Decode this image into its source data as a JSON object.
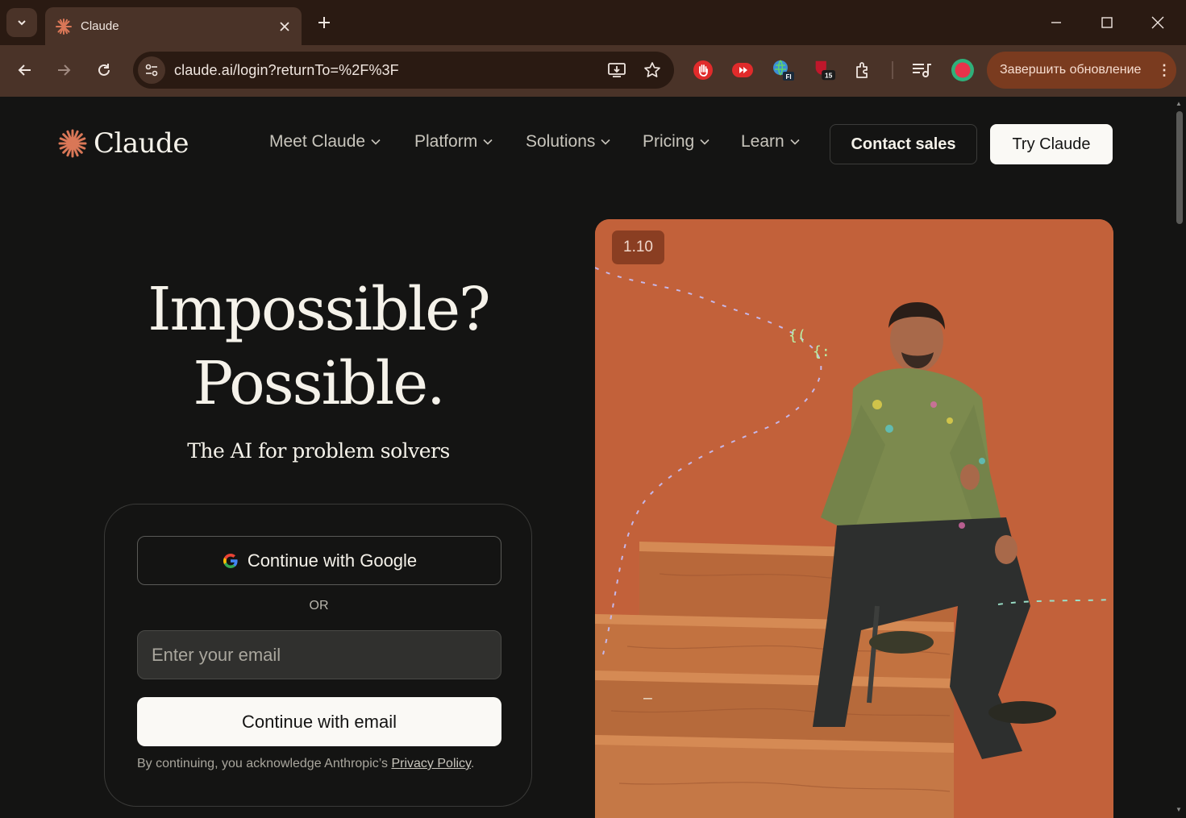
{
  "browser": {
    "tab_title": "Claude",
    "url": "claude.ai/login?returnTo=%2F%3F",
    "update_label": "Завершить обновление",
    "extension_badges": {
      "vpn": "FI",
      "shield": "15"
    },
    "colors": {
      "tabbar": "#2a1a12",
      "toolbar": "#4a3328",
      "update_button": "#7a3b1f"
    }
  },
  "header": {
    "logo_text": "Claude",
    "nav": [
      "Meet Claude",
      "Platform",
      "Solutions",
      "Pricing",
      "Learn"
    ],
    "contact_sales": "Contact sales",
    "try_claude": "Try Claude"
  },
  "hero": {
    "title_line1": "Impossible?",
    "title_line2": "Possible.",
    "subtitle": "The AI for problem solvers"
  },
  "login": {
    "google_label": "Continue with Google",
    "or_label": "OR",
    "email_placeholder": "Enter your email",
    "email_value": "",
    "email_button": "Continue with email",
    "legal_prefix": "By continuing, you acknowledge Anthropic’s ",
    "legal_link": "Privacy Policy",
    "legal_suffix": "."
  },
  "media": {
    "version_badge": "1.10",
    "colors": {
      "background": "#c2613a",
      "accent": "#d97757"
    }
  }
}
